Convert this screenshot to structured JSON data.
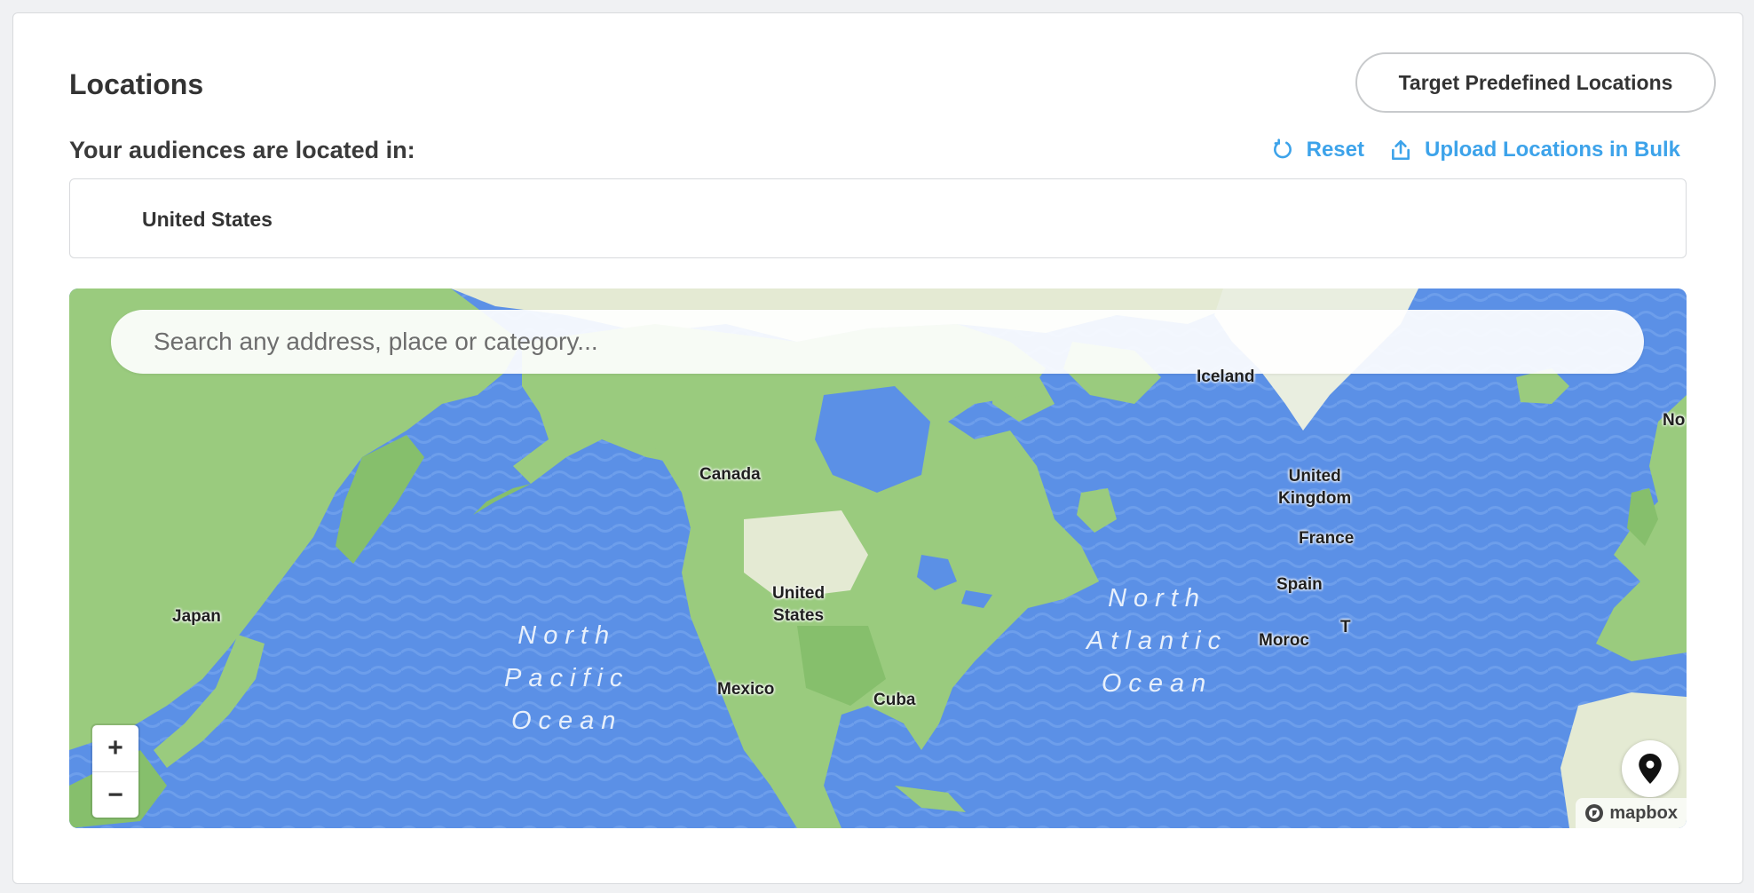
{
  "section": {
    "title": "Locations",
    "predefined_button": "Target Predefined Locations",
    "subtitle": "Your audiences are located in:",
    "reset_label": "Reset",
    "upload_label": "Upload Locations in Bulk"
  },
  "selected_locations": [
    "United States"
  ],
  "map": {
    "search_placeholder": "Search any address, place or category...",
    "labels": {
      "iceland": "Iceland",
      "norway_partial": "No",
      "canada": "Canada",
      "uk_line1": "United",
      "uk_line2": "Kingdom",
      "france": "France",
      "spain": "Spain",
      "morocco": "Moroc",
      "tunisia_partial": "T",
      "japan": "Japan",
      "us_line1": "United",
      "us_line2": "States",
      "mexico": "Mexico",
      "cuba": "Cuba"
    },
    "oceans": {
      "north_pacific": "North\nPacific\nOcean",
      "north_atlantic": "North\nAtlantic\nOcean"
    },
    "zoom_in": "+",
    "zoom_out": "−",
    "attribution": "mapbox",
    "colors": {
      "ocean": "#5b90e6",
      "land": "#9acb7e",
      "land_dark": "#86bf6c",
      "land_light": "#e4ead3",
      "accent": "#3da3ea"
    }
  }
}
